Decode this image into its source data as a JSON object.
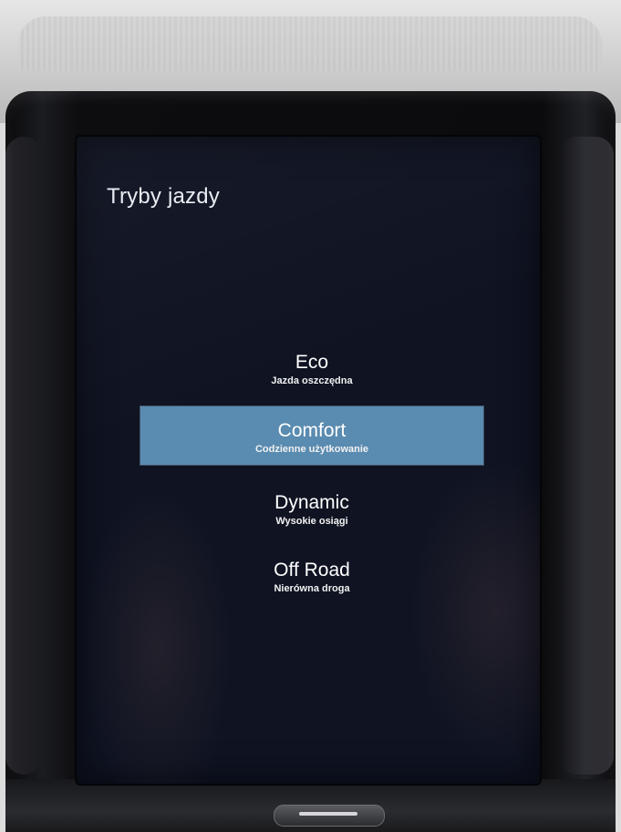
{
  "screen": {
    "title": "Tryby jazdy",
    "accent_color": "#5a8bb0",
    "background_color": "#0f1322"
  },
  "drive_modes": [
    {
      "name": "Eco",
      "description": "Jazda oszczędna",
      "selected": false
    },
    {
      "name": "Comfort",
      "description": "Codzienne użytkowanie",
      "selected": true
    },
    {
      "name": "Dynamic",
      "description": "Wysokie osiągi",
      "selected": false
    },
    {
      "name": "Off Road",
      "description": "Nierówna droga",
      "selected": false
    }
  ],
  "hardware": {
    "home_button_icon": "home-bar-icon"
  }
}
